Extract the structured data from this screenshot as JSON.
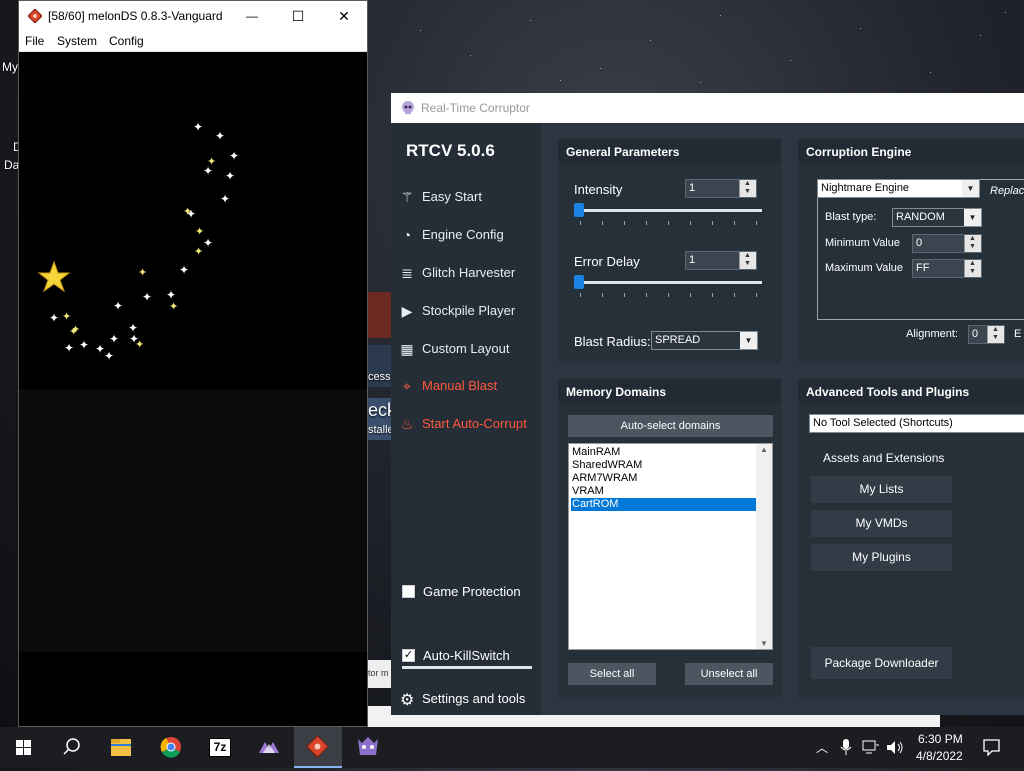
{
  "desktop": {
    "fragments": [
      "My",
      "Da",
      "D",
      "cesse",
      "eck",
      "stalle",
      "tor m"
    ]
  },
  "melonds": {
    "title": "[58/60] melonDS 0.8.3-Vanguard",
    "menu": [
      "File",
      "System",
      "Config"
    ],
    "controls": {
      "minimize": "—",
      "maximize": "☐",
      "close": "✕"
    }
  },
  "rtcv": {
    "window_title": "Real-Time Corruptor",
    "version": "RTCV 5.0.6",
    "nav": [
      {
        "label": "Easy Start",
        "icon": "wand-icon"
      },
      {
        "label": "Engine Config",
        "icon": "gauge-icon"
      },
      {
        "label": "Glitch Harvester",
        "icon": "layers-icon"
      },
      {
        "label": "Stockpile Player",
        "icon": "play-icon"
      },
      {
        "label": "Custom Layout",
        "icon": "grid-icon"
      },
      {
        "label": "Manual Blast",
        "icon": "crosshair-icon"
      },
      {
        "label": "Start Auto-Corrupt",
        "icon": "flame-icon"
      }
    ],
    "game_protection": "Game Protection",
    "auto_killswitch": "Auto-KillSwitch",
    "settings_tools": "Settings and tools",
    "general": {
      "title": "General Parameters",
      "intensity_label": "Intensity",
      "intensity_value": "1",
      "error_delay_label": "Error Delay",
      "error_delay_value": "1",
      "blast_radius_label": "Blast Radius:",
      "blast_radius_value": "SPREAD"
    },
    "engine": {
      "title": "Corruption Engine",
      "engine_value": "Nightmare Engine",
      "replace_label": "Replace",
      "blast_type_label": "Blast type:",
      "blast_type_value": "RANDOM",
      "min_label": "Minimum Value",
      "min_value": "0",
      "max_label": "Maximum Value",
      "max_value": "FF",
      "alignment_label": "Alignment:",
      "alignment_value": "0",
      "cut_label": "E"
    },
    "memory": {
      "title": "Memory Domains",
      "auto_select": "Auto-select domains",
      "domains": [
        "MainRAM",
        "SharedWRAM",
        "ARM7WRAM",
        "VRAM",
        "CartROM"
      ],
      "selected_index": 4,
      "select_all": "Select all",
      "unselect_all": "Unselect all"
    },
    "tools": {
      "title": "Advanced Tools and Plugins",
      "tool_select": "No Tool Selected (Shortcuts)",
      "assets_label": "Assets and Extensions",
      "my_lists": "My Lists",
      "my_vmds": "My VMDs",
      "my_plugins": "My Plugins",
      "package_downloader": "Package Downloader"
    }
  },
  "taskbar": {
    "apps": [
      "windows-start-icon",
      "search-icon",
      "file-explorer-icon",
      "chrome-icon",
      "7zip-icon",
      "vanguard-icon",
      "melonds-icon",
      "rtc-icon"
    ],
    "sevenzip_label": "7z",
    "time": "6:30 PM",
    "date": "4/8/2022"
  }
}
